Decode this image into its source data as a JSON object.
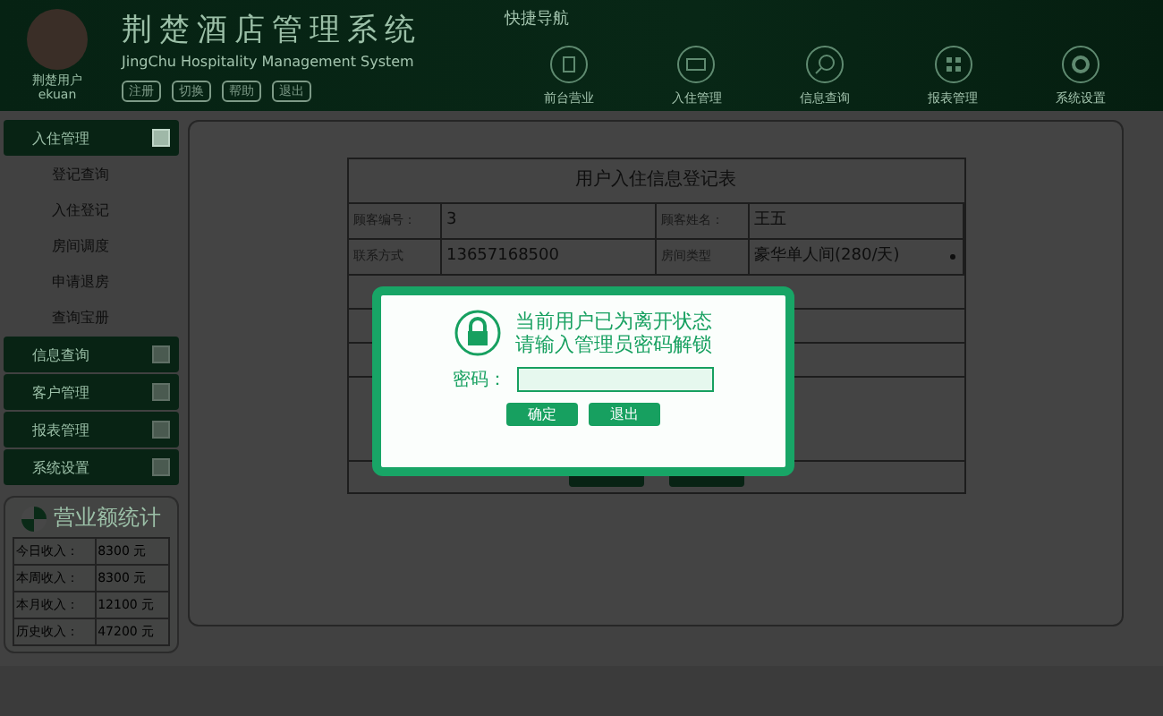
{
  "header": {
    "logo_caption": "荆楚用户",
    "logo_caption_2": "ekuan",
    "title": "荆楚酒店管理系统",
    "subtitle": "JingChu Hospitality Management System",
    "links": [
      "注册",
      "切换",
      "帮助",
      "退出"
    ],
    "quick_nav_label": "快捷导航",
    "quick_nav": [
      {
        "label": "前台营业"
      },
      {
        "label": "入住管理"
      },
      {
        "label": "信息查询"
      },
      {
        "label": "报表管理"
      },
      {
        "label": "系统设置"
      }
    ]
  },
  "sidebar": {
    "sections": [
      {
        "label": "入住管理",
        "expanded": true,
        "children": [
          {
            "label": "登记查询"
          },
          {
            "label": "入住登记"
          },
          {
            "label": "房间调度"
          },
          {
            "label": "申请退房"
          },
          {
            "label": "查询宝册"
          }
        ]
      },
      {
        "label": "信息查询",
        "expanded": false
      },
      {
        "label": "客户管理",
        "expanded": false
      },
      {
        "label": "报表管理",
        "expanded": false
      },
      {
        "label": "系统设置",
        "expanded": false
      }
    ]
  },
  "income": {
    "title": "营业额统计",
    "rows": [
      {
        "label": "今日收入：",
        "value": "8300 元"
      },
      {
        "label": "本周收入：",
        "value": "8300 元"
      },
      {
        "label": "本月收入：",
        "value": "12100 元"
      },
      {
        "label": "历史收入：",
        "value": "47200 元"
      }
    ]
  },
  "form": {
    "title": "用户入住信息登记表",
    "fields": [
      {
        "label": "顾客编号：",
        "value": "3",
        "kind": "text"
      },
      {
        "label": "顾客姓名：",
        "value": "王五",
        "kind": "text"
      },
      {
        "label": "联系方式",
        "value": "13657168500",
        "kind": "text"
      },
      {
        "label": "房间类型",
        "value": "豪华单人间(280/天)",
        "kind": "select"
      }
    ]
  },
  "dialog": {
    "lines": [
      "当前用户已为离开状态",
      "请输入管理员密码解锁"
    ],
    "password_label": "密码：",
    "buttons": [
      "确定",
      "退出"
    ]
  }
}
